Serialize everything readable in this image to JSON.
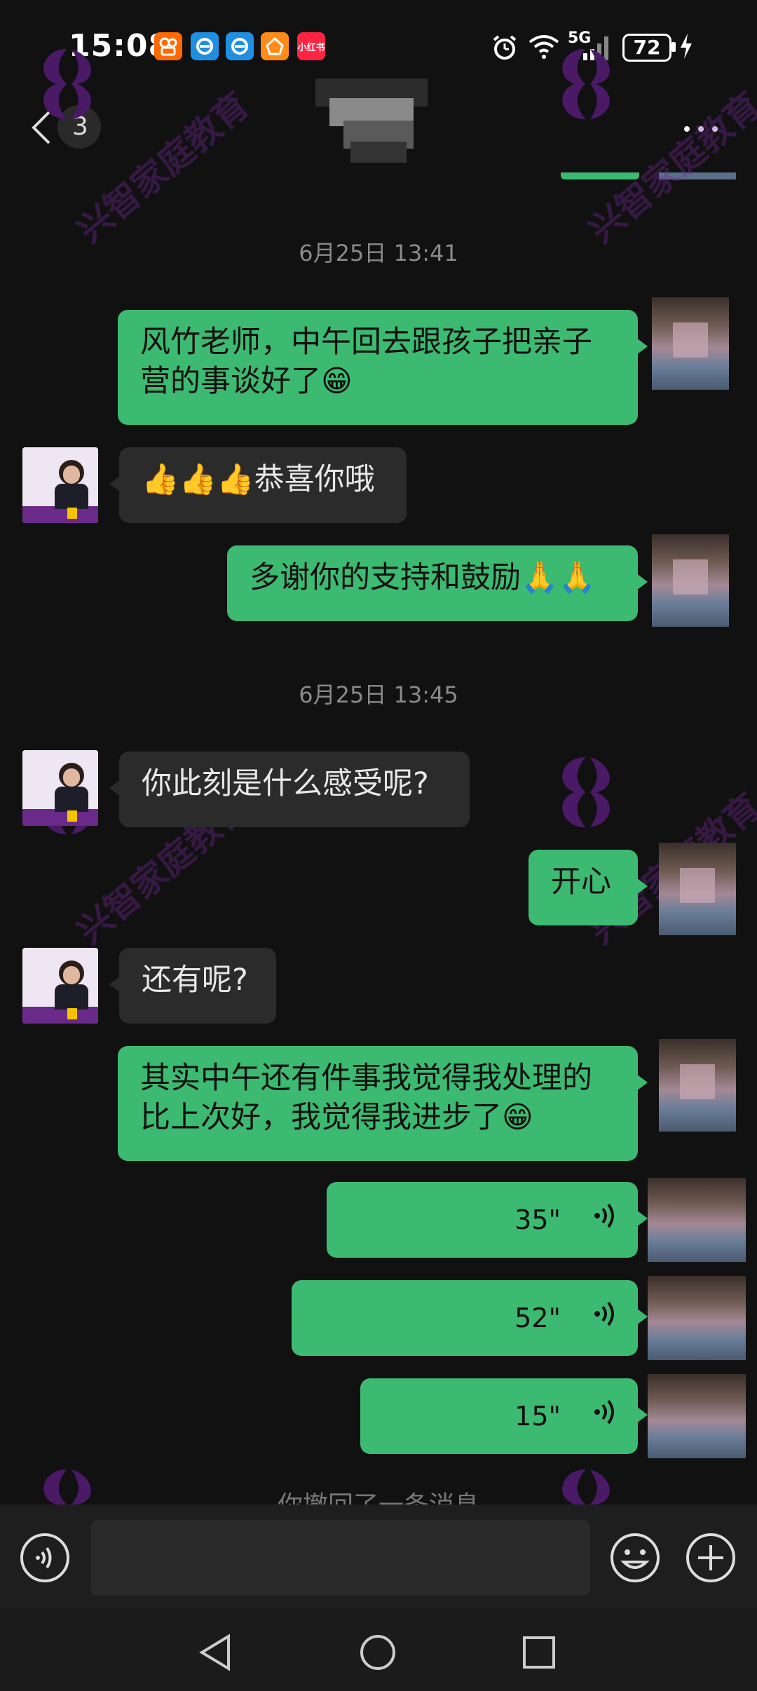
{
  "status_bar": {
    "time": "15:08",
    "apps": [
      {
        "name": "kuaishou",
        "color": "#ff6a00",
        "label": ""
      },
      {
        "name": "eleme-1",
        "color": "#1e8fe1",
        "label": ""
      },
      {
        "name": "eleme-2",
        "color": "#1e8fe1",
        "label": ""
      },
      {
        "name": "app-orange",
        "color": "#ff8c1a",
        "label": ""
      },
      {
        "name": "xiaohongshu",
        "color": "#ff2442",
        "label": "小红书"
      }
    ],
    "network": "5G",
    "battery": "72"
  },
  "header": {
    "back_count": "3"
  },
  "messages": {
    "ts1": "6月25日 13:41",
    "m1": "风竹老师，中午回去跟孩子把亲子营的事谈好了😁",
    "m1_line1": "风竹老师，中午回去跟孩子把亲子",
    "m1_line2": "营的事谈好了😁",
    "m2": "👍👍👍恭喜你哦",
    "m3": "多谢你的支持和鼓励🙏🙏",
    "ts2": "6月25日 13:45",
    "m4": "你此刻是什么感受呢?",
    "m5": "开心",
    "m6": "还有呢?",
    "m7_line1": "其实中午还有件事我觉得我处理的",
    "m7_line2": "比上次好，我觉得我进步了😁",
    "v1": "35\"",
    "v2": "52\"",
    "v3": "15\"",
    "recalled": "你撤回了一条消息"
  },
  "watermark": {
    "text": "兴智家庭教育",
    "color": "#7a28a0"
  },
  "colors": {
    "my_bubble": "#3dba71",
    "other_bubble": "#2b2b2b",
    "background": "#111111"
  },
  "icons": {
    "back": "chevron-left-icon",
    "more": "more-dots-icon",
    "voice": "voice-wave-icon",
    "voice_input": "voice-input-icon",
    "emoji": "emoji-icon",
    "plus": "plus-icon",
    "nav_back": "triangle-back-icon",
    "nav_home": "circle-home-icon",
    "nav_recent": "square-recent-icon"
  }
}
